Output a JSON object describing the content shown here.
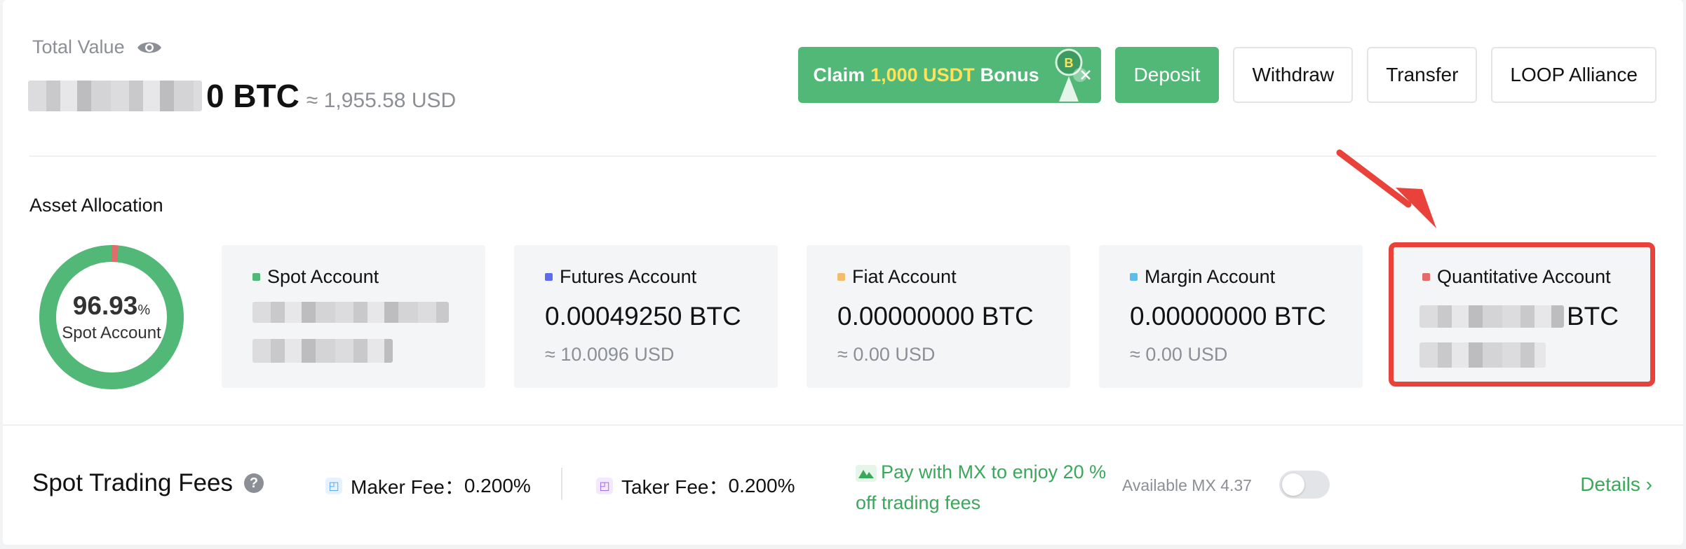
{
  "header": {
    "total_value_label": "Total Value",
    "total_btc_suffix": "0 BTC",
    "total_usd": "≈ 1,955.58 USD",
    "eye_icon": "eye-icon"
  },
  "actions": {
    "claim_prefix": "Claim",
    "claim_amount": "1,000 USDT",
    "claim_suffix": "Bonus",
    "deposit": "Deposit",
    "withdraw": "Withdraw",
    "transfer": "Transfer",
    "loop": "LOOP Alliance"
  },
  "allocation": {
    "title": "Asset Allocation",
    "donut_percent": "96.93",
    "donut_percent_unit": "%",
    "donut_label": "Spot Account",
    "spot_share": 0.9693,
    "accounts": [
      {
        "name": "Spot Account",
        "color": "#52b877",
        "value": "",
        "usd": ""
      },
      {
        "name": "Futures Account",
        "color": "#5b6cf0",
        "value": "0.00049250 BTC",
        "usd": "≈ 10.0096 USD"
      },
      {
        "name": "Fiat Account",
        "color": "#f5bd6b",
        "value": "0.00000000 BTC",
        "usd": "≈ 0.00 USD"
      },
      {
        "name": "Margin Account",
        "color": "#5bbcee",
        "value": "0.00000000 BTC",
        "usd": "≈ 0.00 USD"
      },
      {
        "name": "Quantitative Account",
        "color": "#e46b6b",
        "value_suffix": "BTC",
        "usd": ""
      }
    ]
  },
  "fees": {
    "title": "Spot Trading Fees",
    "help": "?",
    "maker_label": "Maker Fee：",
    "maker_value": "0.200%",
    "taker_label": "Taker Fee：",
    "taker_value": "0.200%",
    "promo_line1": "Pay with MX to enjoy 20 %",
    "promo_line2": "off trading fees",
    "available": "Available MX 4.37",
    "details": "Details ›"
  },
  "colors": {
    "brand_green": "#52b877",
    "annotation_red": "#e8423b"
  }
}
